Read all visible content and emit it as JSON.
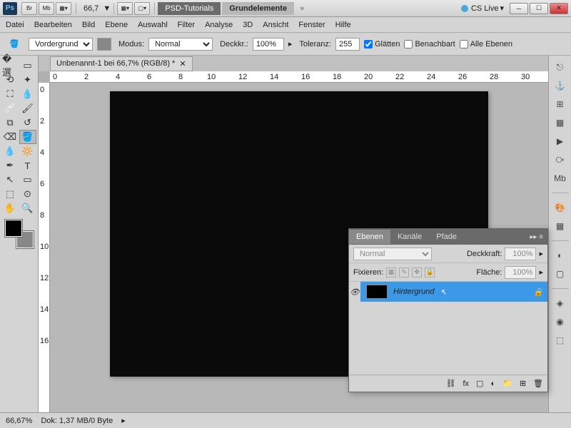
{
  "title": {
    "zoom_label": "66,7",
    "arrow": "▼"
  },
  "tabs": {
    "tutorials": "PSD-Tutorials",
    "grund": "Grundelemente"
  },
  "cslive": "CS Live",
  "menu": [
    "Datei",
    "Bearbeiten",
    "Bild",
    "Ebene",
    "Auswahl",
    "Filter",
    "Analyse",
    "3D",
    "Ansicht",
    "Fenster",
    "Hilfe"
  ],
  "opt": {
    "vordergrund": "Vordergrund",
    "modus": "Modus:",
    "normal": "Normal",
    "deckkr": "Deckkr.:",
    "deckkr_val": "100%",
    "toleranz": "Toleranz:",
    "tol_val": "255",
    "glaetten": "Glätten",
    "benachbart": "Benachbart",
    "alle": "Alle Ebenen"
  },
  "doc_tab": "Unbenannt-1 bei 66,7% (RGB/8) *",
  "ruler_h": [
    "0",
    "2",
    "4",
    "6",
    "8",
    "10",
    "12",
    "14",
    "16",
    "18",
    "20",
    "22",
    "24",
    "26",
    "28",
    "30"
  ],
  "ruler_v": [
    "0",
    "2",
    "4",
    "6",
    "8",
    "10",
    "12",
    "14",
    "16"
  ],
  "status": {
    "zoom": "66,67%",
    "dok": "Dok: 1,37 MB/0 Byte"
  },
  "layers": {
    "tabs": [
      "Ebenen",
      "Kanäle",
      "Pfade"
    ],
    "blend": "Normal",
    "deck_lbl": "Deckkraft:",
    "deck_val": "100%",
    "fix": "Fixieren:",
    "flaeche": "Fläche:",
    "flaeche_val": "100%",
    "layer_name": "Hintergrund"
  }
}
